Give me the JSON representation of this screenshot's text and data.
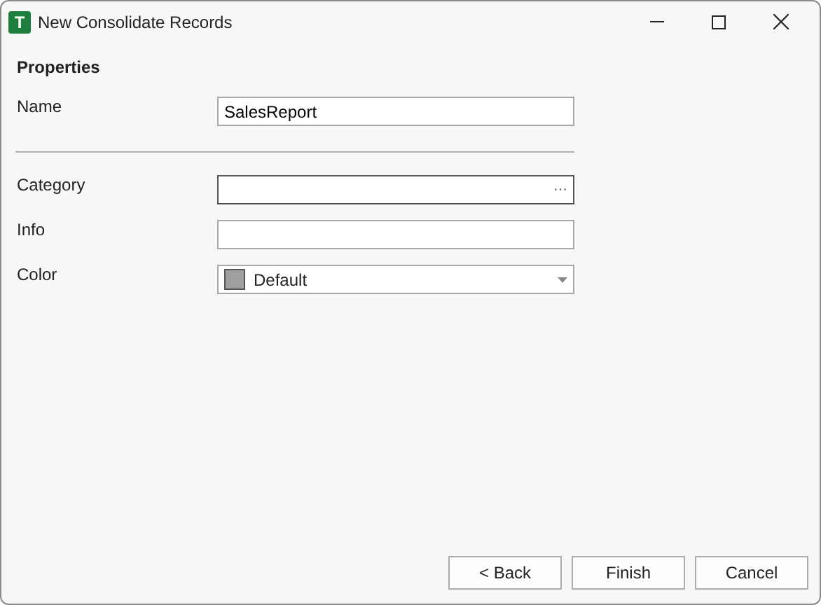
{
  "window": {
    "title": "New Consolidate Records",
    "app_icon_letter": "T"
  },
  "section": {
    "title": "Properties"
  },
  "name_field": {
    "label": "Name",
    "value": "SalesReport",
    "focused": false
  },
  "fields": [
    {
      "kind": "browse",
      "label": "Category",
      "button": "···",
      "focused": true
    },
    {
      "kind": "text",
      "label": "Info",
      "focused": false
    },
    {
      "kind": "color",
      "label": "Color",
      "value": "Default",
      "color": "#a0a0a0",
      "focused": false
    }
  ],
  "buttons": [
    "< Back",
    "Finish",
    "Cancel"
  ]
}
